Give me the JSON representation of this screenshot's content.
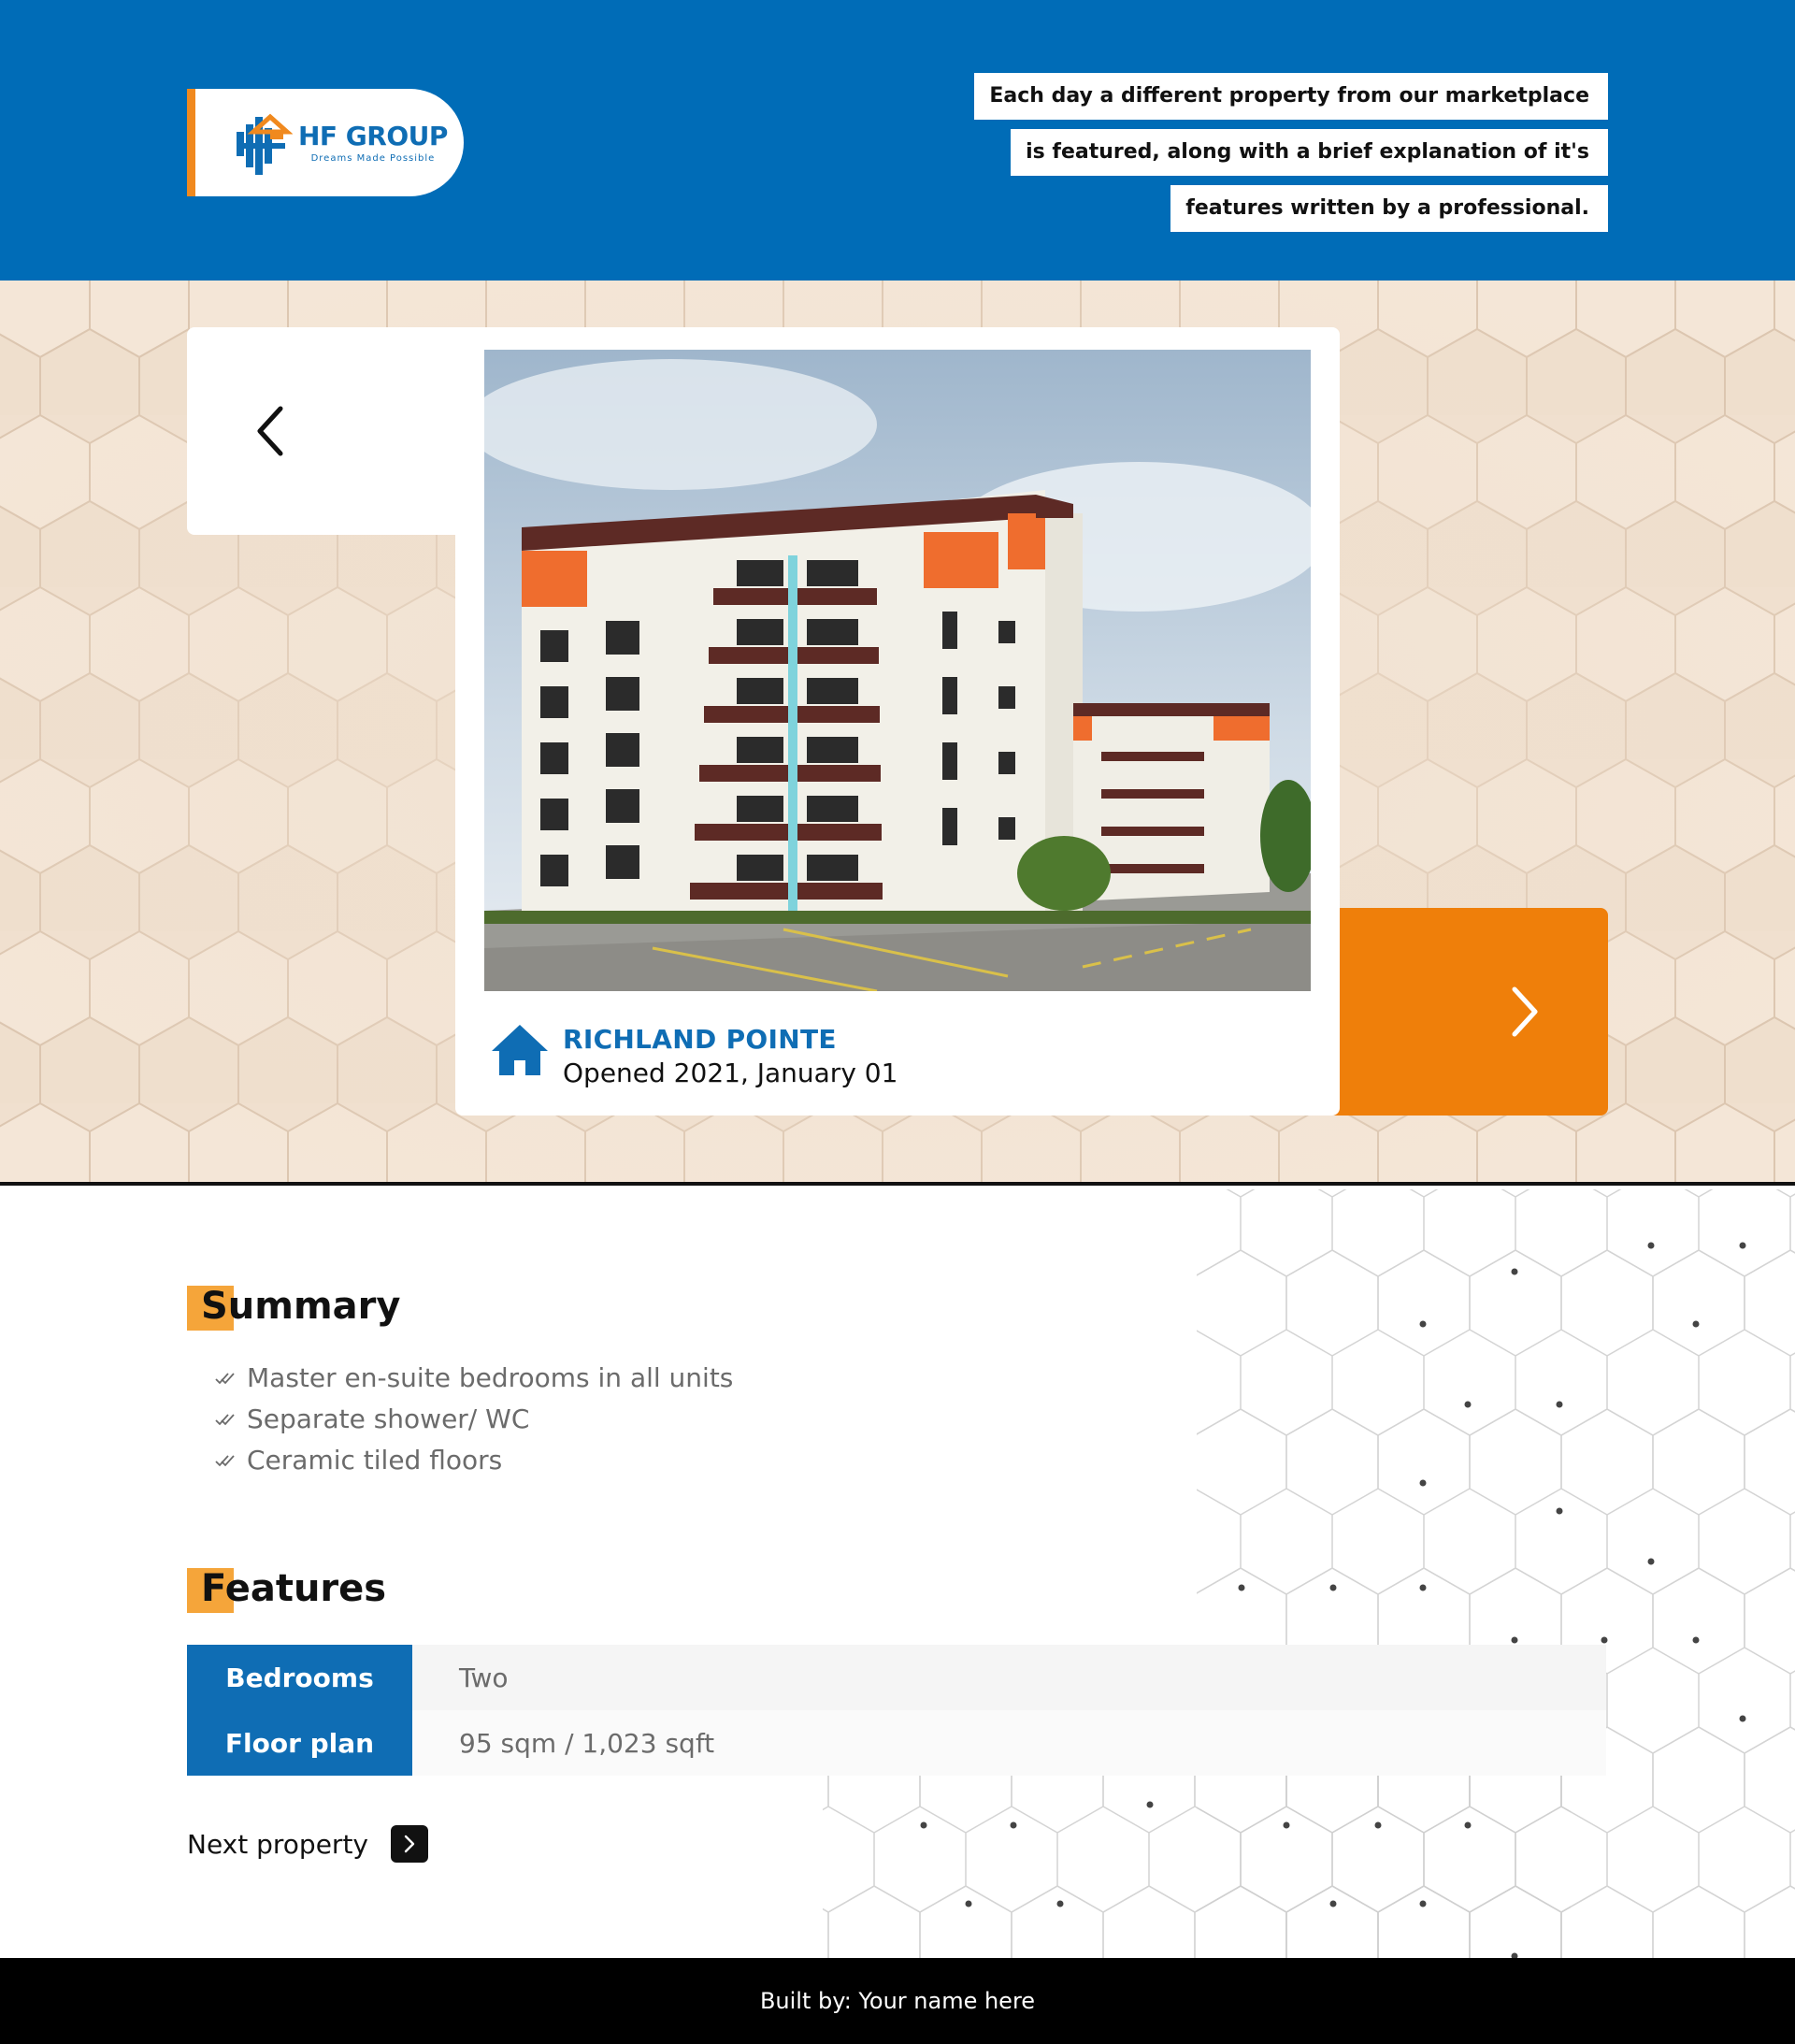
{
  "header": {
    "logo": {
      "name": "HF GROUP",
      "tagline": "Dreams Made Possible"
    },
    "tagline_lines": [
      "Each day a different property from our marketplace",
      "is featured, along with a brief explanation of it's",
      "features written by a professional."
    ]
  },
  "carousel": {
    "prev_icon": "chevron-left-icon",
    "next_icon": "chevron-right-icon",
    "property": {
      "name": "RICHLAND POINTE",
      "opened": "Opened 2021, January 01",
      "icon": "house-icon"
    }
  },
  "summary": {
    "title": "Summary",
    "items": [
      "Master en-suite bedrooms in all units",
      "Separate shower/ WC",
      "Ceramic tiled floors"
    ]
  },
  "features": {
    "title": "Features",
    "rows": [
      {
        "key": "Bedrooms",
        "value": "Two"
      },
      {
        "key": "Floor plan",
        "value": "95 sqm / 1,023 sqft"
      }
    ]
  },
  "next_property": {
    "label": "Next property"
  },
  "footer": {
    "text": "Built by: Your name here"
  },
  "colors": {
    "brand_blue": "#006cb7",
    "accent_orange": "#ef7f0a",
    "highlight_orange": "#f5a53a",
    "hero_bg": "#f0e0cf",
    "footer_bg": "#000000"
  }
}
